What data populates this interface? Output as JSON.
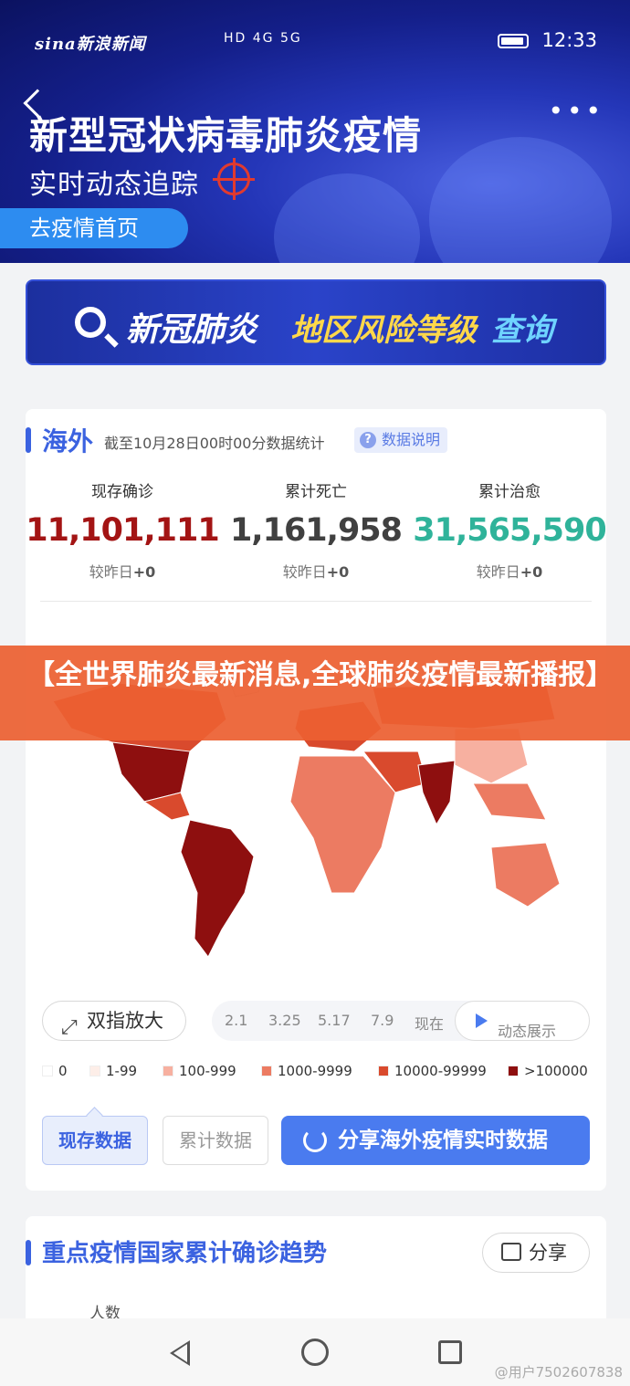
{
  "status_bar": {
    "logo": "sina新浪新闻",
    "network": "HD 4G 5G",
    "time": "12:33"
  },
  "hero": {
    "title": "新型冠状病毒肺炎疫情",
    "subtitle": "实时动态追踪",
    "home_button": "去疫情首页"
  },
  "risk_banner": {
    "part1": "新冠肺炎",
    "part2": "地区风险等级",
    "part3": "查询"
  },
  "overseas": {
    "title": "海外",
    "note": "截至10月28日00时00分数据统计",
    "info_button": "数据说明",
    "stats": [
      {
        "label": "现存确诊",
        "value": "11,101,111",
        "delta_prefix": "较昨日",
        "delta": "+0",
        "color": "#a31414"
      },
      {
        "label": "累计死亡",
        "value": "1,161,958",
        "delta_prefix": "较昨日",
        "delta": "+0",
        "color": "#404040"
      },
      {
        "label": "累计治愈",
        "value": "31,565,590",
        "delta_prefix": "较昨日",
        "delta": "+0",
        "color": "#2fb39a"
      }
    ],
    "zoom_button": "双指放大",
    "timeline": [
      "2.1",
      "3.25",
      "5.17",
      "7.9",
      "现在"
    ],
    "play_button": "动态展示",
    "legend": [
      {
        "label": "0",
        "color": "#ffffff"
      },
      {
        "label": "1-99",
        "color": "#fdeee8"
      },
      {
        "label": "100-999",
        "color": "#f7b0a0"
      },
      {
        "label": "1000-9999",
        "color": "#ec7b62"
      },
      {
        "label": "10000-99999",
        "color": "#d94a2d"
      },
      {
        "label": ">100000",
        "color": "#8e0f0f"
      }
    ],
    "tab_current": "现存数据",
    "tab_total": "累计数据",
    "share_button": "分享海外疫情实时数据"
  },
  "overlay_caption": "【全世界肺炎最新消息,全球肺炎疫情最新播报】",
  "trend": {
    "title": "重点疫情国家累计确诊趋势",
    "share_button": "分享",
    "y_label": "人数"
  },
  "watermark": "@用户7502607838"
}
